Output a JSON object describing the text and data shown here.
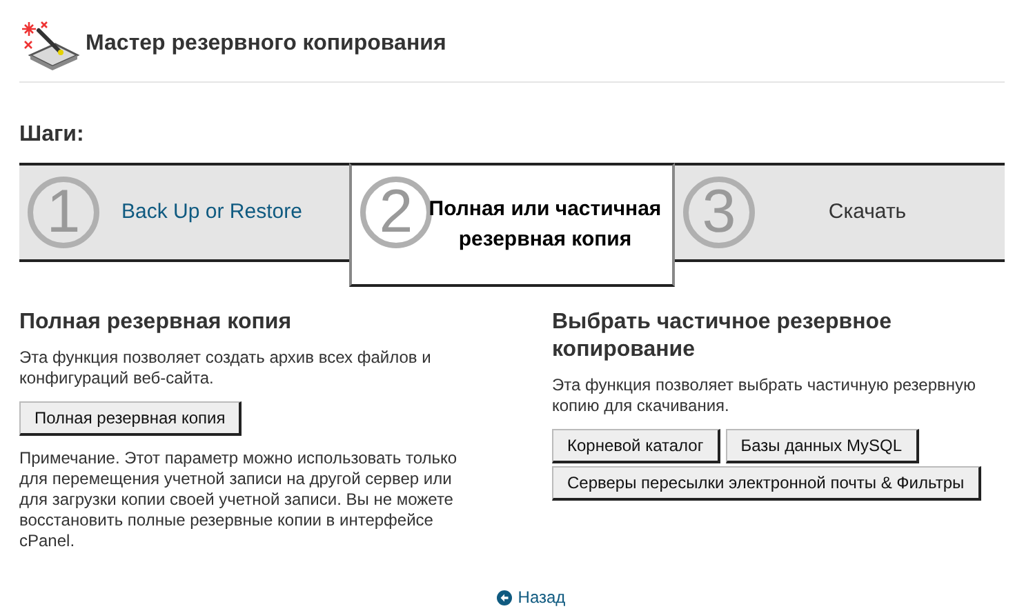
{
  "header": {
    "title": "Мастер резервного копирования"
  },
  "steps_title": "Шаги:",
  "steps": [
    {
      "number": "1",
      "label": "Back Up or Restore",
      "kind": "link",
      "selected": false
    },
    {
      "number": "2",
      "label": "Полная или частичная резервная копия",
      "kind": "text",
      "selected": true
    },
    {
      "number": "3",
      "label": "Скачать",
      "kind": "text",
      "selected": false
    }
  ],
  "sections": [
    {
      "title": "Полная резервная копия",
      "description": "Эта функция позволяет создать архив всех файлов и конфигураций веб-сайта.",
      "buttons": [
        "Полная резервная копия"
      ],
      "note": "Примечание. Этот параметр можно использовать только для перемещения учетной записи на другой сервер или для загрузки копии своей учетной записи. Вы не можете восстановить полные резервные копии в интерфейсе cPanel."
    },
    {
      "title": "Выбрать частичное резервное копирование",
      "description": "Эта функция позволяет выбрать частичную резервную копию для скачивания.",
      "buttons": [
        "Корневой каталог",
        "Базы данных MySQL",
        "Серверы пересылки электронной почты & Фильтры"
      ]
    }
  ],
  "back_link": "Назад"
}
